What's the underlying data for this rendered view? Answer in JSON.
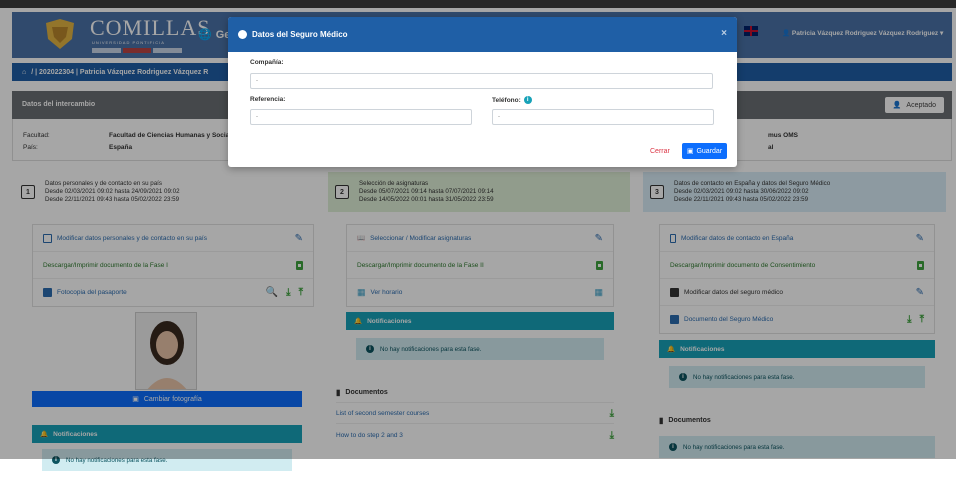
{
  "header": {
    "logo": "COMILLAS",
    "logo_sub": "UNIVERSIDAD PONTIFICIA",
    "brand": "Gesti",
    "user": "Patricia Vázquez Rodriguez Vázquez Rodriguez ▾"
  },
  "breadcrumb": "/ | 202022304 | Patricia Vázquez Rodriguez Vázquez R",
  "exchange": {
    "title": "Datos del intercambio",
    "status": "Aceptado",
    "faculty_label": "Facultad:",
    "faculty_value": "Facultad de Ciencias Humanas y Socia",
    "country_label": "País:",
    "country_value": "España",
    "program_value": "mus OMS",
    "program_value2": "al"
  },
  "modal": {
    "title": "Datos del Seguro Médico",
    "company_label": "Compañía:",
    "company_value": "-",
    "reference_label": "Referencia:",
    "reference_value": "-",
    "phone_label": "Teléfono:",
    "phone_value": "-",
    "cancel": "Cerrar",
    "save": "Guardar"
  },
  "phases": [
    {
      "num": "1",
      "title": "Datos personales y de contacto en su país",
      "date1": "Desde 02/03/2021 09:02 hasta 24/09/2021 09:02",
      "date2": "Desde 22/11/2021 09:43 hasta 05/02/2022 23:59",
      "items": [
        "Modificar datos personales y de contacto en su país",
        "Descargar/Imprimir documento de la Fase I",
        "Fotocopia del pasaporte"
      ],
      "photo_btn": "Cambiar fotografía",
      "notif_title": "Notificaciones",
      "notif_msg": "No hay notificaciones para esta fase."
    },
    {
      "num": "2",
      "title": "Selección de asignaturas",
      "date1": "Desde 05/07/2021 09:14 hasta 07/07/2021 09:14",
      "date2": "Desde 14/05/2022 00:01 hasta 31/05/2022 23:59",
      "items": [
        "Seleccionar / Modificar asignaturas",
        "Descargar/Imprimir documento de la Fase II",
        "Ver horario"
      ],
      "notif_title": "Notificaciones",
      "notif_msg": "No hay notificaciones para esta fase.",
      "docs_title": "Documentos",
      "docs": [
        "List of second semester courses",
        "How to do step 2 and 3"
      ]
    },
    {
      "num": "3",
      "title": "Datos de contacto en España y datos del Seguro Médico",
      "date1": "Desde 02/03/2021 09:02 hasta 30/06/2022 09:02",
      "date2": "Desde 22/11/2021 09:43 hasta 05/02/2022 23:59",
      "items": [
        "Modificar datos de contacto en España",
        "Descargar/Imprimir documento de Consentimiento",
        "Modificar datos del seguro médico",
        "Documento del Seguro Médico"
      ],
      "notif_title": "Notificaciones",
      "notif_msg": "No hay notificaciones para esta fase.",
      "docs_title": "Documentos",
      "docs_msg": "No hay notificaciones para esta fase."
    }
  ]
}
